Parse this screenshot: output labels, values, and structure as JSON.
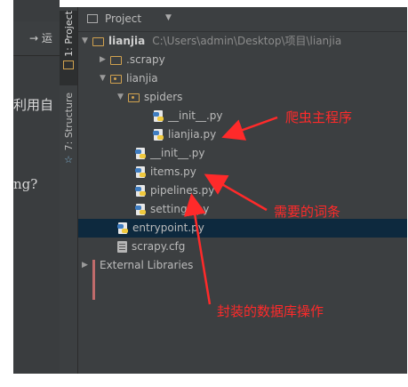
{
  "background_pane": {
    "fragment_top": "→ 运",
    "fragment_mid": "利用自",
    "fragment_low": "ng?"
  },
  "tool_strip": {
    "project_tab": "1: Project",
    "structure_tab": "7: Structure"
  },
  "panel": {
    "title": "Project",
    "root": {
      "name": "lianjia",
      "path": "C:\\Users\\admin\\Desktop\\项目\\lianjia"
    },
    "tree": [
      {
        "label": ".scrapy"
      },
      {
        "label": "lianjia"
      },
      {
        "label": "spiders"
      },
      {
        "label": "__init__.py"
      },
      {
        "label": "lianjia.py"
      },
      {
        "label": "__init__.py"
      },
      {
        "label": "items.py"
      },
      {
        "label": "pipelines.py"
      },
      {
        "label": "settings.py"
      },
      {
        "label": "entrypoint.py"
      },
      {
        "label": "scrapy.cfg"
      },
      {
        "label": "External Libraries"
      }
    ]
  },
  "annotations": {
    "crawler_main": "爬虫主程序",
    "needed_fields": "需要的词条",
    "db_ops": "封装的数据库操作"
  },
  "colors": {
    "annotation": "#ff2a2a",
    "panel_bg": "#3c3f41",
    "selection": "#0d293e",
    "folder": "#d1a24f"
  }
}
